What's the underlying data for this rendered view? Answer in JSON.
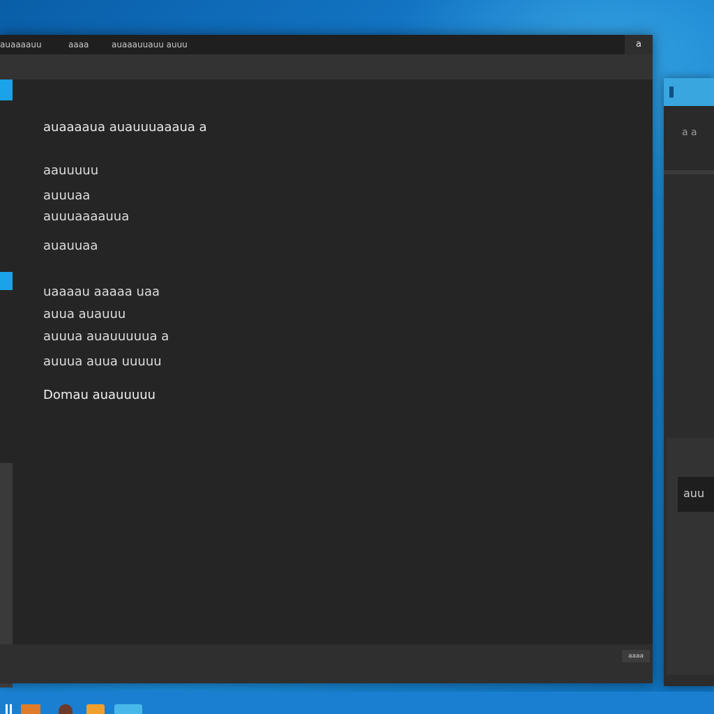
{
  "window": {
    "title_items": [
      "auaaaauu",
      "aaaa",
      "auaaauuauu auuu"
    ],
    "title_right": "a",
    "content_lines": [
      "auaaaaua auauuuaaaua a",
      "aauuuuu",
      "auuuaa",
      "auuuaaaauua",
      "auauuaa",
      "uaaaau aaaaa uaa",
      "auua auauuu",
      "auuua auauuuuua a",
      "auuua auua uuuuu",
      "Domau auauuuuu"
    ],
    "status_chip": "aaaa"
  },
  "side_window": {
    "header_text": "a a",
    "field_text": "auu"
  },
  "taskbar": {
    "icons": [
      "start-icon",
      "folder-icon",
      "person-icon",
      "app-icon",
      "app2-icon"
    ]
  },
  "colors": {
    "accent": "#1aa3e8",
    "window_bg": "#252525",
    "desktop": "#1478c8"
  }
}
